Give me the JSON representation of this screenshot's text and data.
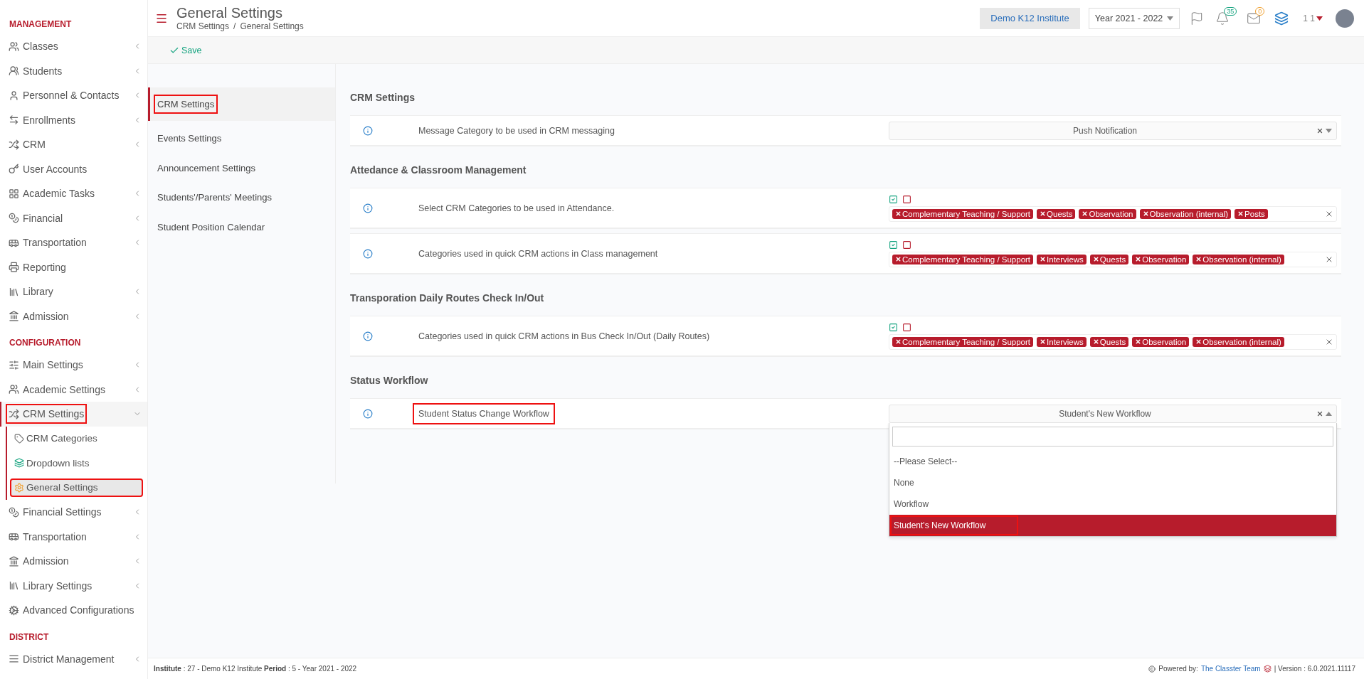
{
  "sidebar": {
    "sections": [
      {
        "title": "MANAGEMENT",
        "items": [
          {
            "label": "Classes",
            "expandable": true,
            "expanded": false,
            "selected": false,
            "highlighted": false
          },
          {
            "label": "Students",
            "expandable": true,
            "expanded": false,
            "selected": false,
            "highlighted": false
          },
          {
            "label": "Personnel & Contacts",
            "expandable": true,
            "expanded": false,
            "selected": false,
            "highlighted": false
          },
          {
            "label": "Enrollments",
            "expandable": true,
            "expanded": false,
            "selected": false,
            "highlighted": false
          },
          {
            "label": "CRM",
            "expandable": true,
            "expanded": false,
            "selected": false,
            "highlighted": false
          },
          {
            "label": "User Accounts",
            "expandable": false,
            "selected": false,
            "highlighted": false
          },
          {
            "label": "Academic Tasks",
            "expandable": true,
            "expanded": false,
            "selected": false,
            "highlighted": false
          },
          {
            "label": "Financial",
            "expandable": true,
            "expanded": false,
            "selected": false,
            "highlighted": false
          },
          {
            "label": "Transportation",
            "expandable": true,
            "expanded": false,
            "selected": false,
            "highlighted": false
          },
          {
            "label": "Reporting",
            "expandable": false,
            "selected": false,
            "highlighted": false
          },
          {
            "label": "Library",
            "expandable": true,
            "expanded": false,
            "selected": false,
            "highlighted": false
          },
          {
            "label": "Admission",
            "expandable": true,
            "expanded": false,
            "selected": false,
            "highlighted": false
          }
        ]
      },
      {
        "title": "CONFIGURATION",
        "items": [
          {
            "label": "Main Settings",
            "expandable": true,
            "expanded": false,
            "selected": false,
            "highlighted": false
          },
          {
            "label": "Academic Settings",
            "expandable": true,
            "expanded": false,
            "selected": false,
            "highlighted": false
          },
          {
            "label": "CRM Settings",
            "expandable": true,
            "expanded": true,
            "selected": true,
            "highlighted": true,
            "children": [
              {
                "label": "CRM Categories",
                "selected": false,
                "highlighted": false
              },
              {
                "label": "Dropdown lists",
                "selected": false,
                "highlighted": false
              },
              {
                "label": "General Settings",
                "selected": true,
                "highlighted": true
              }
            ]
          },
          {
            "label": "Financial Settings",
            "expandable": true,
            "expanded": false,
            "selected": false,
            "highlighted": false
          },
          {
            "label": "Transportation",
            "expandable": true,
            "expanded": false,
            "selected": false,
            "highlighted": false
          },
          {
            "label": "Admission",
            "expandable": true,
            "expanded": false,
            "selected": false,
            "highlighted": false
          },
          {
            "label": "Library Settings",
            "expandable": true,
            "expanded": false,
            "selected": false,
            "highlighted": false
          },
          {
            "label": "Advanced Configurations",
            "expandable": false,
            "selected": false,
            "highlighted": false
          }
        ]
      },
      {
        "title": "DISTRICT",
        "items": [
          {
            "label": "District Management",
            "expandable": true,
            "expanded": false,
            "selected": false,
            "highlighted": false
          }
        ]
      }
    ]
  },
  "header": {
    "title": "General Settings",
    "breadcrumb": [
      "CRM Settings",
      "/",
      "General Settings"
    ],
    "institute": "Demo K12 Institute",
    "year": "Year 2021 - 2022",
    "notifications": "35",
    "messages": "0",
    "user": "1 1"
  },
  "toolbar": {
    "save": "Save"
  },
  "settings_menu": [
    {
      "label": "CRM Settings",
      "selected": true,
      "highlighted": true
    },
    {
      "label": "Events Settings",
      "selected": false,
      "highlighted": false
    },
    {
      "label": "Announcement Settings",
      "selected": false,
      "highlighted": false
    },
    {
      "label": "Students'/Parents' Meetings",
      "selected": false,
      "highlighted": false
    },
    {
      "label": "Student Position Calendar",
      "selected": false,
      "highlighted": false
    }
  ],
  "sections": [
    {
      "title": "CRM Settings",
      "rows": [
        {
          "kind": "select",
          "label": "Message Category to be used in CRM messaging",
          "highlighted": false,
          "value": "Push Notification",
          "open": false
        }
      ]
    },
    {
      "title": "Attedance & Classroom Management",
      "rows": [
        {
          "kind": "tags",
          "label": "Select CRM Categories to be used in Attendance.",
          "highlighted": false,
          "tags": [
            "Complementary Teaching / Support",
            "Quests",
            "Observation",
            "Observation (internal)",
            "Posts"
          ]
        },
        {
          "kind": "tags",
          "label": "Categories used in quick CRM actions in Class management",
          "highlighted": false,
          "tags": [
            "Complementary Teaching / Support",
            "Interviews",
            "Quests",
            "Observation",
            "Observation (internal)"
          ]
        }
      ]
    },
    {
      "title": "Transporation Daily Routes Check In/Out",
      "rows": [
        {
          "kind": "tags",
          "label": "Categories used in quick CRM actions in Bus Check In/Out (Daily Routes)",
          "highlighted": false,
          "tags": [
            "Complementary Teaching / Support",
            "Interviews",
            "Quests",
            "Observation",
            "Observation (internal)"
          ]
        }
      ]
    },
    {
      "title": "Status Workflow",
      "rows": [
        {
          "kind": "select",
          "label": "Student Status Change Workflow",
          "highlighted": true,
          "value": "Student's New Workflow",
          "open": true,
          "options": [
            {
              "label": "--Please Select--",
              "selected": false,
              "highlighted": false
            },
            {
              "label": "None",
              "selected": false,
              "highlighted": false
            },
            {
              "label": "Workflow",
              "selected": false,
              "highlighted": false
            },
            {
              "label": "Student's New Workflow",
              "selected": true,
              "highlighted": true
            }
          ]
        }
      ]
    }
  ],
  "footer": {
    "info": "**Institute** : 27 - Demo K12 Institute **Period** : 5 - Year 2021 - 2022",
    "powered": "Powered by:",
    "team": "The Classter Team",
    "version": "| Version : 6.0.2021.11117"
  }
}
